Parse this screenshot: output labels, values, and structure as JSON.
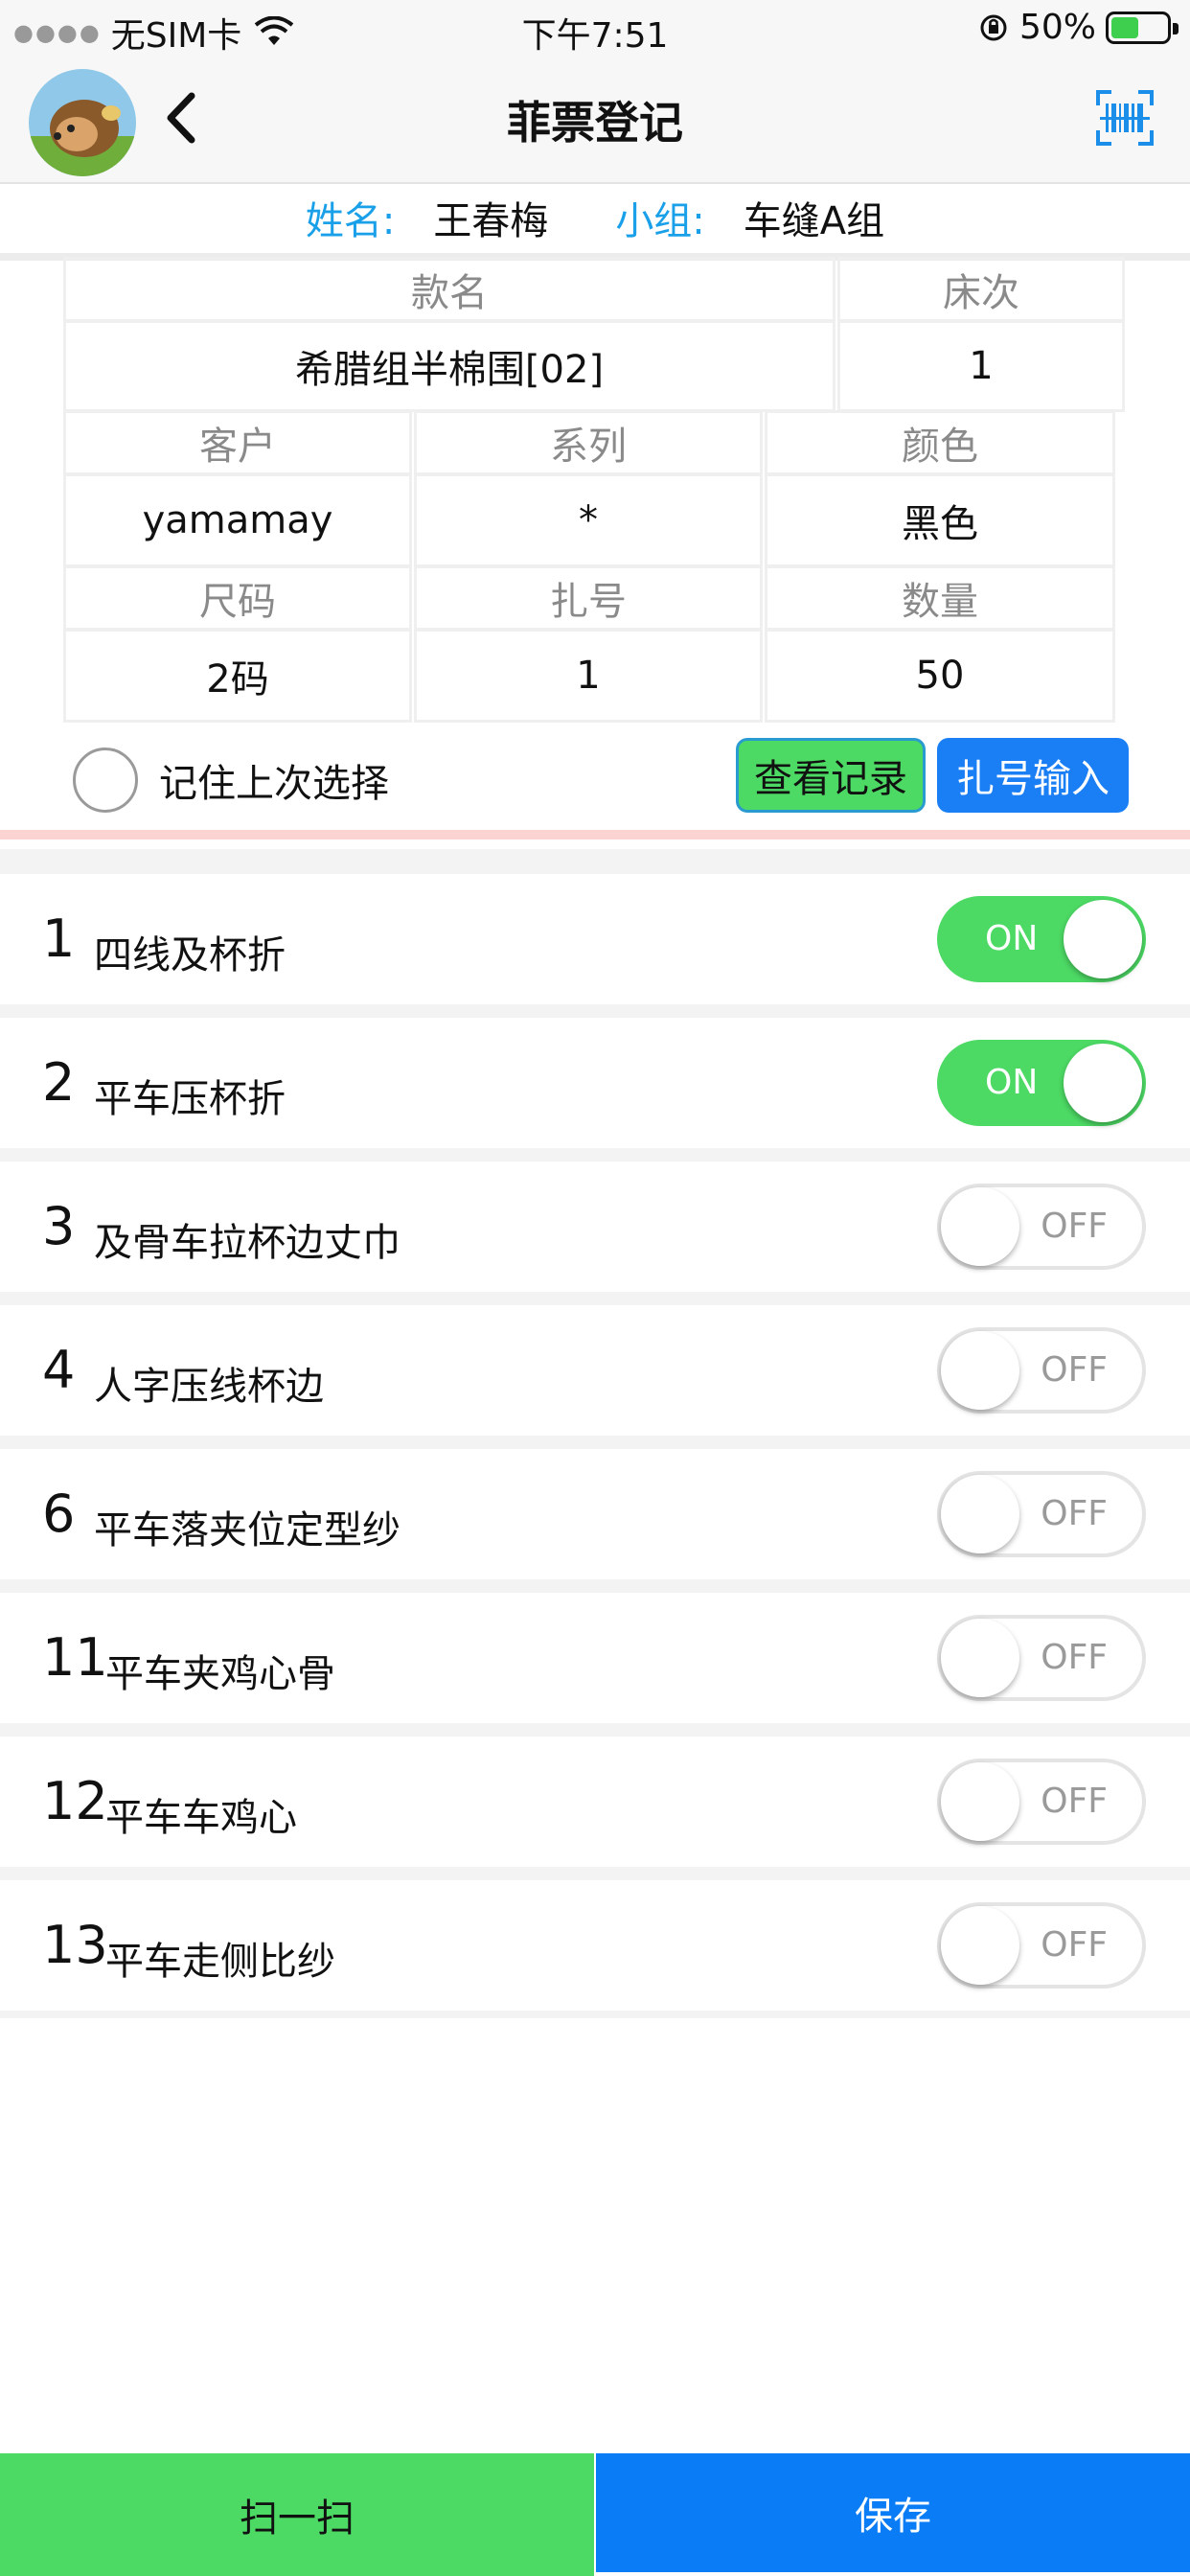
{
  "status_bar": {
    "carrier": "无SIM卡",
    "time": "下午7:51",
    "battery": "50%",
    "battery_level": 0.5
  },
  "nav": {
    "title": "菲票登记",
    "back_icon": "chevron-left-icon",
    "scan_icon": "barcode-scan-icon"
  },
  "info": {
    "name_label": "姓名:",
    "name_value": "王春梅",
    "group_label": "小组:",
    "group_value": "车缝A组"
  },
  "form": {
    "style_name_label": "款名",
    "style_name_value": "希腊组半棉围[02]",
    "bed_label": "床次",
    "bed_value": "1",
    "customer_label": "客户",
    "customer_value": "yamamay",
    "series_label": "系列",
    "series_value": "*",
    "color_label": "颜色",
    "color_value": "黑色",
    "size_label": "尺码",
    "size_value": "2码",
    "bundle_label": "扎号",
    "bundle_value": "1",
    "quantity_label": "数量",
    "quantity_value": "50",
    "remember_label": "记住上次选择",
    "view_records_label": "查看记录",
    "bundle_input_label": "扎号输入"
  },
  "processes": [
    {
      "num": "1",
      "name": "四线及杯折",
      "state": "ON"
    },
    {
      "num": "2",
      "name": "平车压杯折",
      "state": "ON"
    },
    {
      "num": "3",
      "name": "及骨车拉杯边丈巾",
      "state": "OFF"
    },
    {
      "num": "4",
      "name": "人字压线杯边",
      "state": "OFF"
    },
    {
      "num": "6",
      "name": "平车落夹位定型纱",
      "state": "OFF"
    },
    {
      "num": "11",
      "name": "平车夹鸡心骨",
      "state": "OFF"
    },
    {
      "num": "12",
      "name": "平车车鸡心",
      "state": "OFF"
    },
    {
      "num": "13",
      "name": "平车走侧比纱",
      "state": "OFF"
    }
  ],
  "bottom": {
    "scan_label": "扫一扫",
    "save_label": "保存"
  },
  "colors": {
    "accent_blue": "#1aa0e8",
    "toggle_on": "#4cd964",
    "save_blue": "#0a7cf5"
  }
}
